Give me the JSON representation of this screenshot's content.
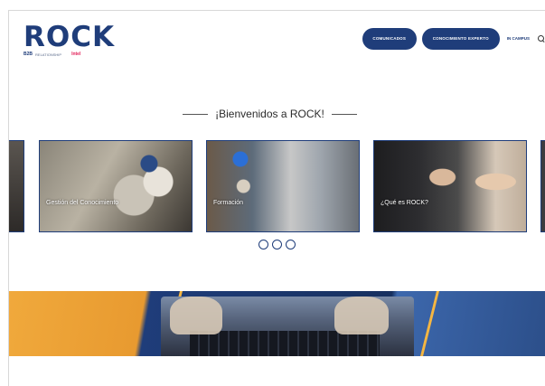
{
  "header": {
    "logo": {
      "word": "ROCK",
      "b2": "B2B",
      "subtitle": "RELATIONSHIP",
      "brand": "Intel"
    },
    "nav": {
      "comunicados_label": "COMUNICADOS",
      "conocimiento_label": "CONOCIMIENTO EXPERTO",
      "campus_label": "IN CAMPUS"
    }
  },
  "welcome": {
    "title": "¡Bienvenidos a ROCK!"
  },
  "carousel": {
    "cards": [
      {
        "label": "Gestión del Conocimiento"
      },
      {
        "label": "Formación"
      },
      {
        "label": "¿Qué es ROCK?"
      }
    ],
    "dots": 3
  },
  "colors": {
    "brand_blue": "#1f3d7a",
    "accent_orange": "#f0a93c"
  },
  "icons": {
    "search": "search-icon"
  }
}
